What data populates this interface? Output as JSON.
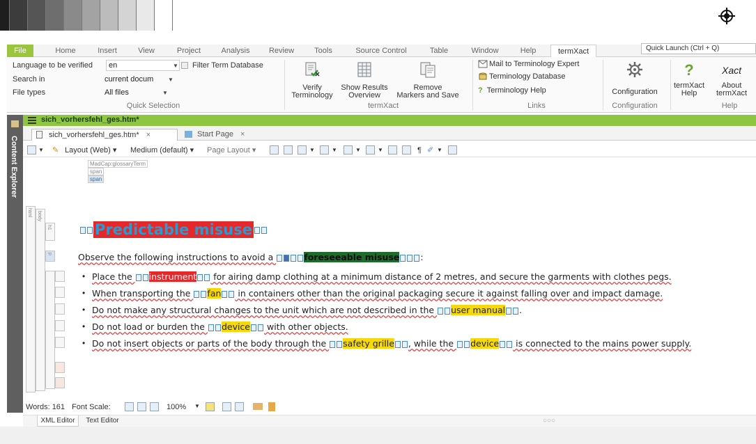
{
  "swatch_colors": [
    "#1e1e1e",
    "#3c3c3c",
    "#555555",
    "#6e6e6e",
    "#8a8a8a",
    "#a3a3a3",
    "#bcbcbc",
    "#d4d4d4",
    "#e9e9e9",
    "#ffffff"
  ],
  "tabs": [
    "File",
    "Home",
    "Insert",
    "View",
    "Project",
    "Analysis",
    "Review",
    "Tools",
    "Source Control",
    "Table",
    "Window",
    "Help",
    "termXact"
  ],
  "quick_launch": "Quick Launch (Ctrl + Q)",
  "quick_selection": {
    "language_label": "Language to be verified",
    "language_value": "en",
    "filter_label": "Filter Term Database",
    "search_label": "Search in",
    "search_value": "current docum",
    "filetypes_label": "File types",
    "filetypes_value": "All files",
    "group_label": "Quick Selection"
  },
  "termxact_group": {
    "verify": [
      "Verify",
      "Terminology"
    ],
    "show_results": [
      "Show Results",
      "Overview"
    ],
    "remove": [
      "Remove",
      "Markers and Save"
    ],
    "group_label": "termXact"
  },
  "links_group": {
    "mail": "Mail to Terminology Expert",
    "database": "Terminology Database",
    "help": "Terminology Help",
    "group_label": "Links"
  },
  "configuration_group": {
    "button": "Configuration",
    "group_label": "Configuration"
  },
  "help_group": {
    "termxact_help": [
      "termXact",
      "Help"
    ],
    "about": [
      "About",
      "termXact"
    ],
    "xact_logo": "Xact",
    "group_label": "Help"
  },
  "content_explorer": "Content Explorer",
  "doc_title": "sich_vorhersfehl_ges.htm*",
  "doc_tabs": [
    {
      "label": "sich_vorhersfehl_ges.htm*",
      "close": "×"
    },
    {
      "label": "Start Page",
      "close": "×"
    }
  ],
  "toolbar": {
    "layout": "Layout (Web)",
    "medium": "Medium (default)",
    "page_layout": "Page Layout"
  },
  "structure": {
    "glossary_tag": "MadCap:glossaryTerm",
    "span1": "span",
    "span2": "span",
    "html": "html",
    "body": "body",
    "h1": "h1",
    "p": "p"
  },
  "document": {
    "heading": "Predictable misuse",
    "intro_before": "Observe the following instructions to avoid a ",
    "intro_term": "foreseeable misuse",
    "intro_after": ":",
    "items": [
      {
        "before": "Place the ",
        "term": "instrument",
        "after": " for airing damp clothing at a minimum distance of 2 metres, and secure the garments with clothes pegs."
      },
      {
        "before": "When transporting the ",
        "term": "fan",
        "after": " in containers other than the original packaging secure it against falling over and impact damage."
      },
      {
        "before": "Do not make any structural changes to the unit which are not described in the ",
        "term": "user manual",
        "after": "."
      },
      {
        "before": "Do not load or burden the ",
        "term": "device",
        "after": " with other objects."
      },
      {
        "before": "Do not insert objects or parts of the body through the ",
        "term": "safety grille",
        "mid": ", while the ",
        "term2": "device",
        "after": " is connected to the mains power supply."
      }
    ]
  },
  "status": {
    "words": "Words: 161",
    "font_scale": "Font Scale:",
    "zoom": "100%"
  },
  "editor_tabs": [
    "XML Editor",
    "Text Editor"
  ],
  "colors": {
    "file_tab": "#9bc53d",
    "doc_title_bar": "#8dc63f",
    "heading_text": "#2a9ad0",
    "highlight_red": "#e5292b",
    "highlight_yellow": "#f5d90a",
    "highlight_green": "#1f6b2c"
  }
}
